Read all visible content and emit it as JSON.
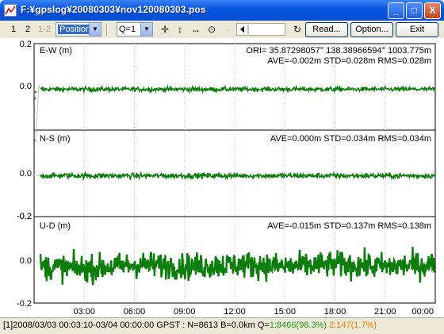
{
  "window": {
    "title": "F:¥gpslog¥20080303¥nov120080303.pos",
    "controls": {
      "minimize": "_",
      "maximize": "□",
      "close": "X"
    }
  },
  "toolbar": {
    "plot1": "1",
    "plot2": "2",
    "plot12": "1-2",
    "plot_type": "Position",
    "quality": "Q=1",
    "read_label": "Read...",
    "option_label": "Option...",
    "exit_label": "Exit"
  },
  "panels": [
    {
      "label": "E-W (m)",
      "stats": "AVE=-0.002m STD=0.028m RMS=0.028m",
      "ori": "ORI= 35.87298057°  138.38966594° 1003.775m"
    },
    {
      "label": "N-S (m)",
      "stats": "AVE=0.000m STD=0.034m RMS=0.034m"
    },
    {
      "label": "U-D (m)",
      "stats": "AVE=-0.015m STD=0.137m RMS=0.138m"
    }
  ],
  "y_ticks": [
    "0.2",
    "0.0",
    "-0.2",
    "0.0",
    "-0.2",
    "0.0",
    "-0.2"
  ],
  "x_ticks": [
    "03:00",
    "06:00",
    "09:00",
    "12:00",
    "15:00",
    "18:00",
    "21:00",
    "00:00"
  ],
  "status": {
    "prefix": "[1]2008/03/03 00:03:10-03/04 00:00:00 GPST : N=8613 B=0.0km Q=",
    "q1": "1:8466(98.3%)",
    "q2": "2:147(1.7%)"
  },
  "colors": {
    "series": "#0a7d0a",
    "q1": "#20a020",
    "q2": "#ff8000",
    "grid": "#c8c8c8"
  },
  "chart_data": [
    {
      "type": "line",
      "title": "",
      "ylabel": "E-W (m)",
      "xlabel": "",
      "ylim": [
        -0.2,
        0.2
      ],
      "x": [
        "00:00",
        "03:00",
        "06:00",
        "09:00",
        "12:00",
        "15:00",
        "18:00",
        "21:00",
        "00:00"
      ],
      "series": [
        {
          "values": [
            0.0,
            0.0,
            0.0,
            0.0,
            0.0,
            0.0,
            0.0,
            0.0,
            0.0
          ],
          "std": 0.028,
          "mean": -0.002
        }
      ]
    },
    {
      "type": "line",
      "title": "",
      "ylabel": "N-S (m)",
      "xlabel": "",
      "ylim": [
        -0.2,
        0.2
      ],
      "x": [
        "00:00",
        "03:00",
        "06:00",
        "09:00",
        "12:00",
        "15:00",
        "18:00",
        "21:00",
        "00:00"
      ],
      "series": [
        {
          "values": [
            0.0,
            0.0,
            0.0,
            0.0,
            0.0,
            0.0,
            0.0,
            0.0,
            0.0
          ],
          "std": 0.034,
          "mean": 0.0
        }
      ]
    },
    {
      "type": "line",
      "title": "",
      "ylabel": "U-D (m)",
      "xlabel": "",
      "ylim": [
        -0.2,
        0.2
      ],
      "x": [
        "00:00",
        "03:00",
        "06:00",
        "09:00",
        "12:00",
        "15:00",
        "18:00",
        "21:00",
        "00:00"
      ],
      "series": [
        {
          "values": [
            -0.02,
            -0.03,
            -0.01,
            -0.02,
            -0.01,
            -0.02,
            -0.01,
            -0.02,
            -0.01
          ],
          "std": 0.137,
          "mean": -0.015
        }
      ]
    }
  ]
}
